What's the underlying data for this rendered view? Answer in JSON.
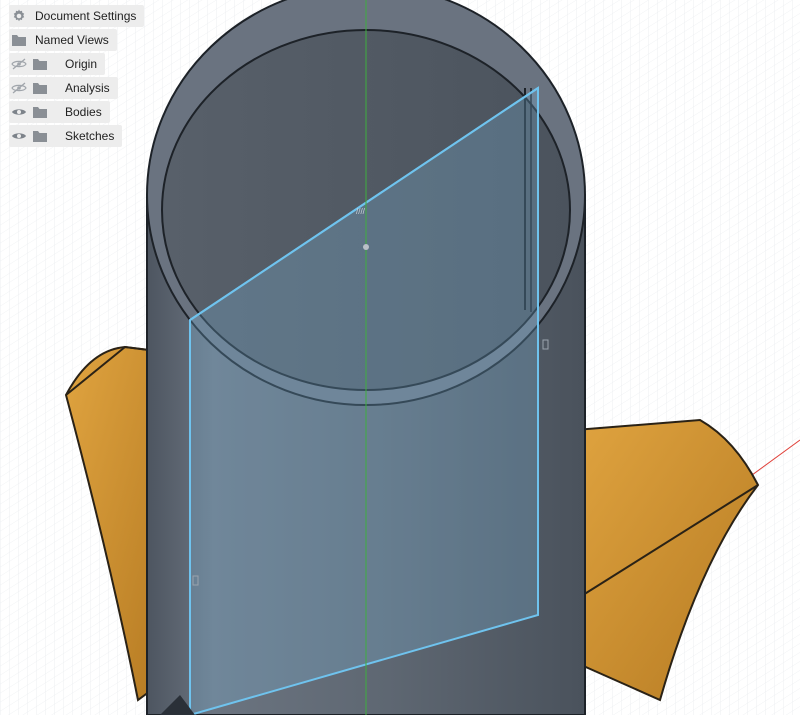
{
  "browser": {
    "items": [
      {
        "label": "Document Settings",
        "icon": "gear-icon",
        "visibility": "none"
      },
      {
        "label": "Named Views",
        "icon": "folder-icon",
        "visibility": "none"
      },
      {
        "label": "Origin",
        "icon": "folder-icon",
        "visibility": "hidden"
      },
      {
        "label": "Analysis",
        "icon": "folder-icon",
        "visibility": "hidden"
      },
      {
        "label": "Bodies",
        "icon": "folder-icon",
        "visibility": "visible"
      },
      {
        "label": "Sketches",
        "icon": "folder-icon",
        "visibility": "visible"
      }
    ]
  },
  "colors": {
    "background": "#ffffff",
    "grid": "#d9dde2",
    "tube": "#5f6873",
    "tube_dark": "#454d57",
    "base": "#c88a2a",
    "sketch_plane": "#7fbfe6",
    "sketch_edge": "#6fc3ee",
    "axis_green": "#3fae3f",
    "axis_red": "#e0413a"
  }
}
